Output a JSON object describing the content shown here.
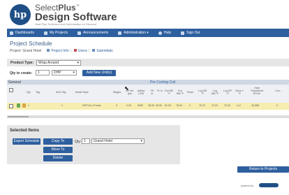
{
  "brand": {
    "logo_text": "hp",
    "name_prefix": "Select",
    "name_suffix": "Plus",
    "trademark": "™",
    "product": "Design Software",
    "tagline": "Heat Pipe Selection and Optimization on Demand"
  },
  "nav": {
    "items": [
      {
        "label": "Dashboards",
        "icon": "dashboard-icon"
      },
      {
        "label": "My Projects",
        "icon": "folder-icon"
      },
      {
        "label": "Announcements",
        "icon": "megaphone-icon"
      },
      {
        "label": "Administration ▾",
        "icon": "admin-icon"
      },
      {
        "label": "Help",
        "icon": "help-icon"
      },
      {
        "label": "Sign Out",
        "icon": "sign-out-icon"
      }
    ]
  },
  "page": {
    "title": "Project Schedule",
    "project_label": "Project:",
    "project_name": "Grand Hotel",
    "links": [
      "Project Info",
      "Users",
      "Submittals"
    ]
  },
  "form": {
    "product_type_label": "Product Type:",
    "product_type_value": "Wrap Around",
    "qty_label": "Qty to create:",
    "qty_value": "1",
    "unit_type_value": "DHP",
    "add_button": "Add New Unit(s)"
  },
  "table": {
    "group_general": "General",
    "group_precooling": "Pre Cooling Coil",
    "headers": [
      "",
      "",
      "Qty",
      "Tag",
      "AHU Tag",
      "Model Style",
      "Stages",
      "Air Vel. fpm",
      "Airflow CFM",
      "FH in",
      "FL in",
      "Ent DB °F",
      "Ent WB °F",
      "Rows",
      "Lvg DB °F",
      "Lvg WB °F",
      "Lvg DP °F",
      "Sens Y °F",
      "Heat Transferred BTU/h",
      "Con..."
    ],
    "row": {
      "qty": "1",
      "tag": "",
      "ahu_tag": "1",
      "model": "DHP-W-x-Frame",
      "stages": "0",
      "air_vel": "0.00",
      "airflow": "5000",
      "fh": "36.00",
      "fl": "36.00",
      "ent_db": "81.00",
      "ent_wb": "78.00",
      "rows": "2",
      "lvg_db": "78.70",
      "lvg_wb": "72.00",
      "lvg_dp": "70.20",
      "sens": "LL2",
      "heat": "40,986",
      "con": "0"
    }
  },
  "selected": {
    "title": "Selected Items",
    "export_button": "Export Schedule",
    "copy_button": "Copy To",
    "move_button": "Move To",
    "delete_button": "Delete",
    "qty_label": "Qty:",
    "qty_value": "1",
    "project_value": "Grand Hotel"
  },
  "footer": {
    "return_button": "Return to Projects",
    "powered_by": "powered by"
  },
  "colors": {
    "nav": "#2e5f9e",
    "button": "#2e5f9e",
    "row_highlight": "#f6edb0",
    "panel": "#e6e6e6"
  }
}
